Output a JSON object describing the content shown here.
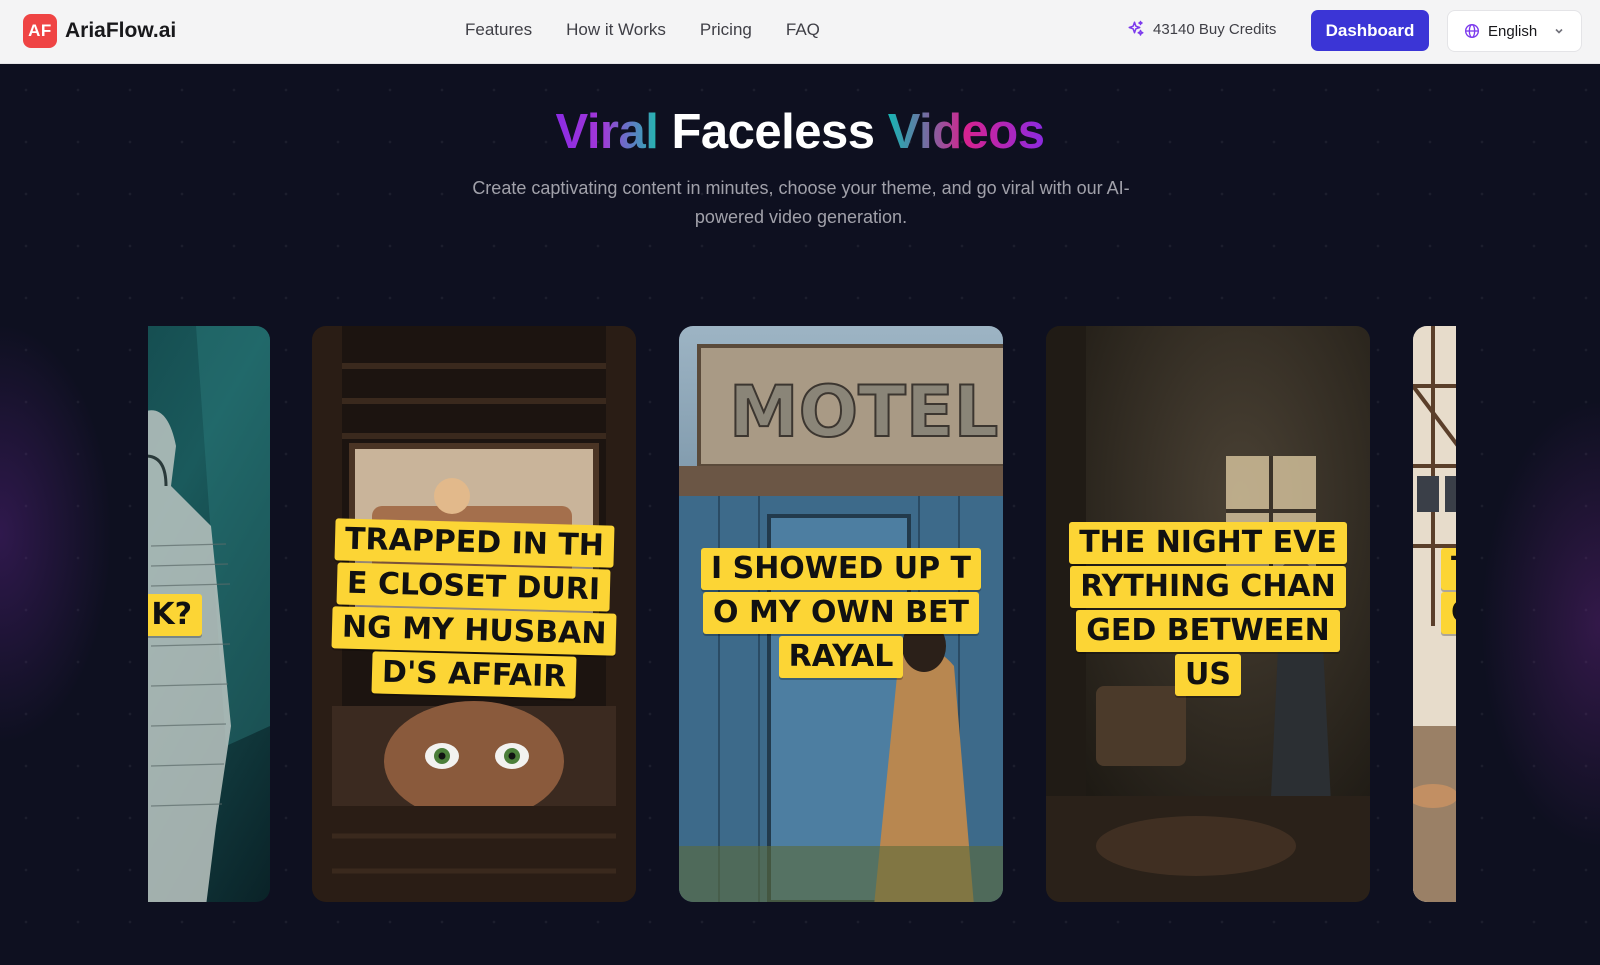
{
  "header": {
    "logo_badge": "AF",
    "brand_name": "AriaFlow.ai",
    "nav": [
      "Features",
      "How it Works",
      "Pricing",
      "FAQ"
    ],
    "credits_label": "43140 Buy Credits",
    "dashboard_label": "Dashboard",
    "language_label": "English"
  },
  "hero": {
    "title_part1": "Viral",
    "title_part2": "Faceless",
    "title_part3": "Videos",
    "subtitle": "Create captivating content in minutes, choose your theme, and go viral with our AI-powered video generation."
  },
  "carousel": {
    "cards": [
      {
        "caption_lines": [
          "K?"
        ]
      },
      {
        "caption_lines": [
          "TRAPPED IN TH",
          "E CLOSET DURI",
          "NG MY HUSBAN",
          "D'S AFFAIR"
        ]
      },
      {
        "caption_lines": [
          "I SHOWED UP T",
          "O MY OWN BET",
          "RAYAL"
        ]
      },
      {
        "caption_lines": [
          "THE NIGHT EVE",
          "RYTHING CHAN",
          "GED BETWEEN",
          "US"
        ]
      },
      {
        "caption_lines": [
          "T",
          "C"
        ]
      }
    ]
  },
  "colors": {
    "brand_red": "#ef4444",
    "dashboard_indigo": "#3b35d6",
    "caption_yellow": "#fcd535",
    "hero_bg": "#0e1020"
  }
}
